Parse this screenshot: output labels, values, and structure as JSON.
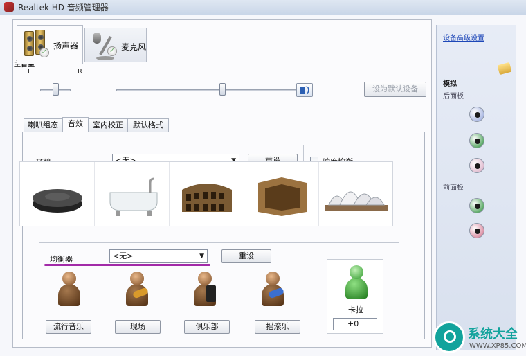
{
  "window": {
    "title": "Realtek HD 音频管理器"
  },
  "device_tabs": [
    {
      "label": "扬声器",
      "active": true
    },
    {
      "label": "麦克风",
      "active": false
    }
  ],
  "volume": {
    "label": "主音量",
    "left_label": "L",
    "right_label": "R",
    "balance_level": 0.5,
    "master_level": 0.58,
    "set_default_label": "设为默认设备"
  },
  "sub_tabs": [
    "喇叭组态",
    "音效",
    "室内校正",
    "默认格式"
  ],
  "environment": {
    "label": "环境",
    "selected": "<无>",
    "reset_label": "重设",
    "loudness_label": "响度均衡",
    "presets": [
      "disc-icon",
      "bathtub-icon",
      "colosseum-icon",
      "stone-room-icon",
      "opera-house-icon"
    ]
  },
  "equalizer": {
    "label": "均衡器",
    "selected": "<无>",
    "reset_label": "重设",
    "presets": [
      "流行音乐",
      "现场",
      "俱乐部",
      "摇滚乐"
    ],
    "karaoke_label": "卡拉",
    "karaoke_value": "+0"
  },
  "side": {
    "advanced_link": "设备高级设置",
    "analog_label": "模拟",
    "back_panel_label": "后面板",
    "front_panel_label": "前面板",
    "back_jacks": [
      "#8ea0d8",
      "#1f8a2e",
      "#d6a6c0"
    ],
    "front_jacks": [
      "#1f8a2e",
      "#d06a86"
    ]
  },
  "watermark": {
    "brand": "系统大全",
    "url": "WWW.XP85.COM"
  }
}
